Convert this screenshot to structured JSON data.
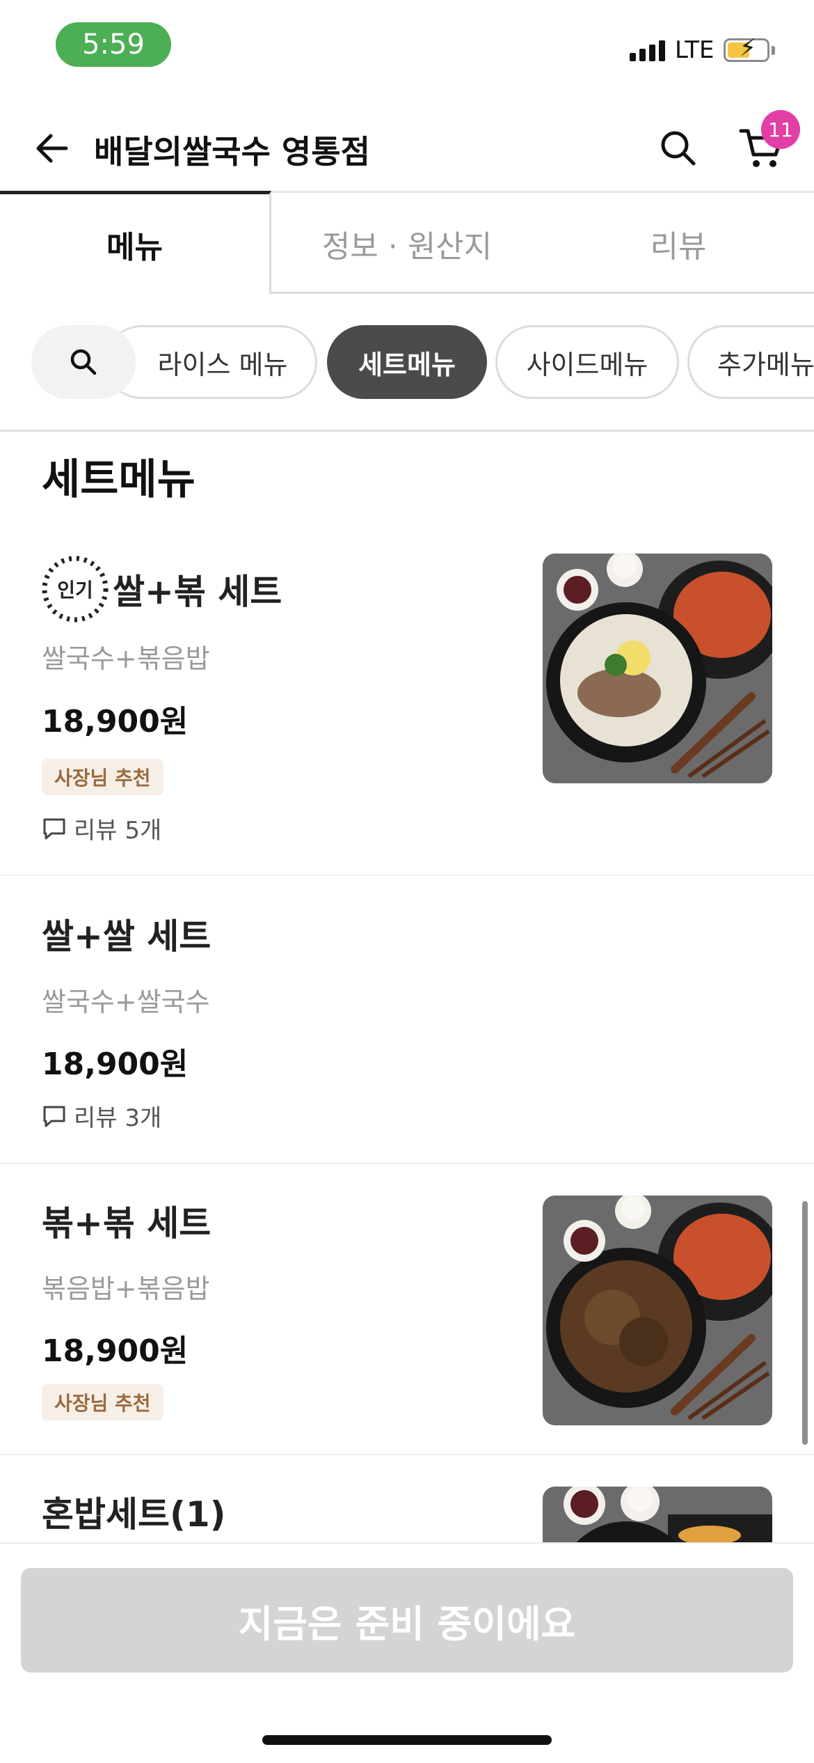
{
  "status_bar": {
    "time": "5:59",
    "network": "LTE"
  },
  "header": {
    "store_name": "배달의쌀국수 영통점",
    "cart_count": "11"
  },
  "tabs": [
    {
      "label": "메뉴"
    },
    {
      "label": "정보 · 원산지"
    },
    {
      "label": "리뷰"
    }
  ],
  "categories": [
    {
      "label": "라이스 메뉴"
    },
    {
      "label": "세트메뉴"
    },
    {
      "label": "사이드메뉴"
    },
    {
      "label": "추가메뉴"
    }
  ],
  "section_title": "세트메뉴",
  "items": [
    {
      "popular_label": "인기",
      "name": "쌀+볶 세트",
      "desc": "쌀국수+볶음밥",
      "price": "18,900원",
      "badge": "사장님 추천",
      "review": "리뷰 5개"
    },
    {
      "name": "쌀+쌀 세트",
      "desc": "쌀국수+쌀국수",
      "price": "18,900원",
      "review": "리뷰 3개"
    },
    {
      "name": "볶+볶 세트",
      "desc": "볶음밥+볶음밥",
      "price": "18,900원",
      "badge": "사장님 추천"
    },
    {
      "name": "혼밥세트(1)"
    }
  ],
  "cta_label": "지금은 준비 중이에요",
  "colors": {
    "status_time_bg": "#4cae55",
    "cart_badge": "#e23fa6",
    "active_chip": "#4a4b4d",
    "badge_bg": "#f6efe7",
    "badge_text": "#9b6a3f",
    "cta_disabled": "#d3d4d6"
  }
}
